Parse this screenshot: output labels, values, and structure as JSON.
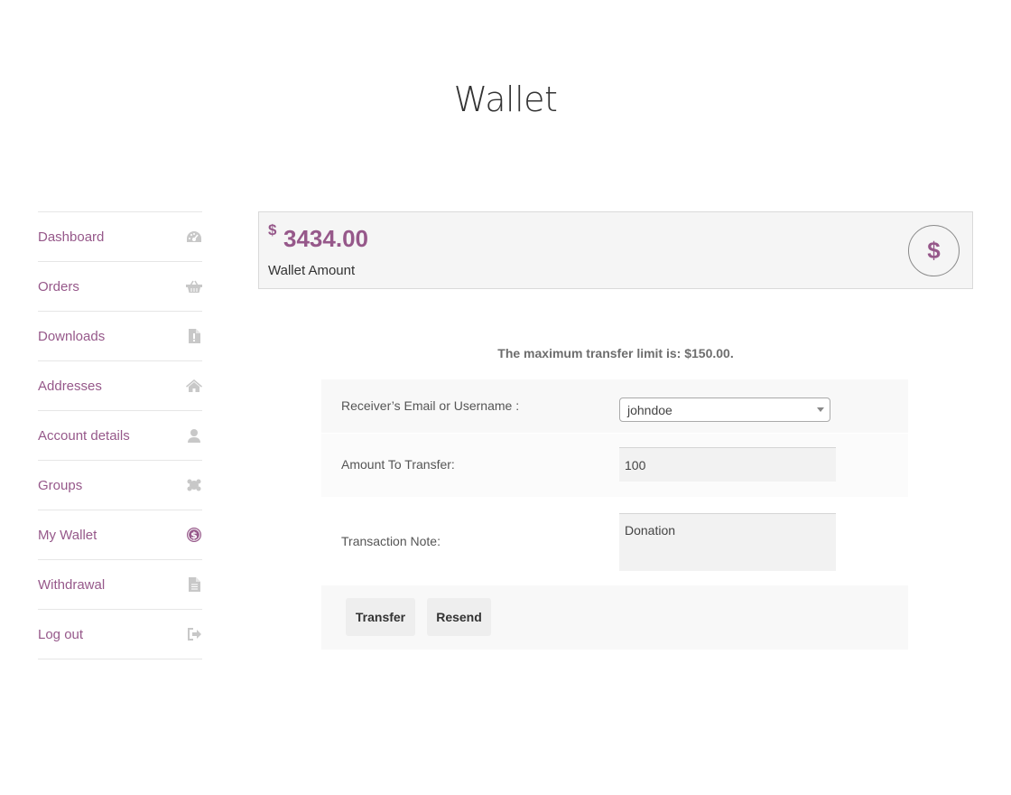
{
  "page": {
    "title": "Wallet"
  },
  "sidebar": {
    "items": [
      {
        "label": "Dashboard",
        "icon": "dashboard-gauge-icon"
      },
      {
        "label": "Orders",
        "icon": "basket-icon"
      },
      {
        "label": "Downloads",
        "icon": "file-download-icon"
      },
      {
        "label": "Addresses",
        "icon": "home-icon"
      },
      {
        "label": "Account details",
        "icon": "user-icon"
      },
      {
        "label": "Groups",
        "icon": "group-icon"
      },
      {
        "label": "My Wallet",
        "icon": "dollar-circle-icon"
      },
      {
        "label": "Withdrawal",
        "icon": "document-icon"
      },
      {
        "label": "Log out",
        "icon": "sign-out-icon"
      }
    ]
  },
  "wallet": {
    "currency_symbol": "$",
    "amount": "3434.00",
    "amount_label": "Wallet Amount",
    "badge_symbol": "$"
  },
  "transfer": {
    "limit_text": "The maximum transfer limit is: $150.00.",
    "receiver_label": "Receiver’s Email or Username :",
    "receiver_value": "johndoe",
    "amount_label": "Amount To Transfer:",
    "amount_value": "100",
    "note_label": "Transaction Note:",
    "note_value": "Donation",
    "transfer_button": "Transfer",
    "resend_button": "Resend"
  },
  "colors": {
    "accent": "#96588a",
    "icon_gray": "#c8c8c8"
  }
}
